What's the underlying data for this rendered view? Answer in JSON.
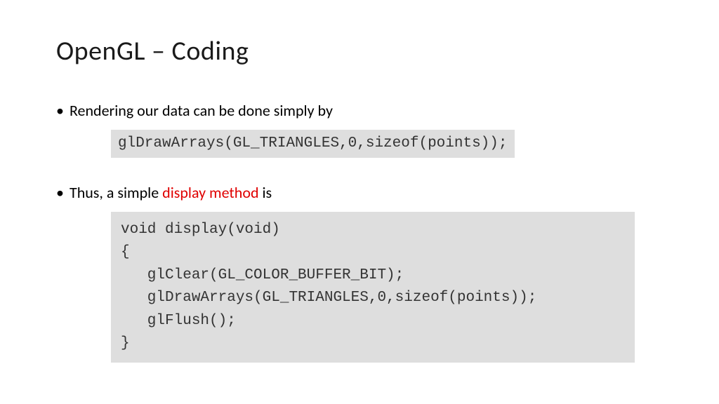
{
  "title": "OpenGL – Coding",
  "bullet1": {
    "dot": "•",
    "text": "Rendering our data can be done simply by"
  },
  "code1": "glDrawArrays(GL_TRIANGLES,0,sizeof(points));",
  "bullet2": {
    "dot": "•",
    "prefix": "Thus, a simple ",
    "highlight": "display method",
    "suffix": " is"
  },
  "code2": "void display(void)\n{\n   glClear(GL_COLOR_BUFFER_BIT);\n   glDrawArrays(GL_TRIANGLES,0,sizeof(points));\n   glFlush();\n}"
}
